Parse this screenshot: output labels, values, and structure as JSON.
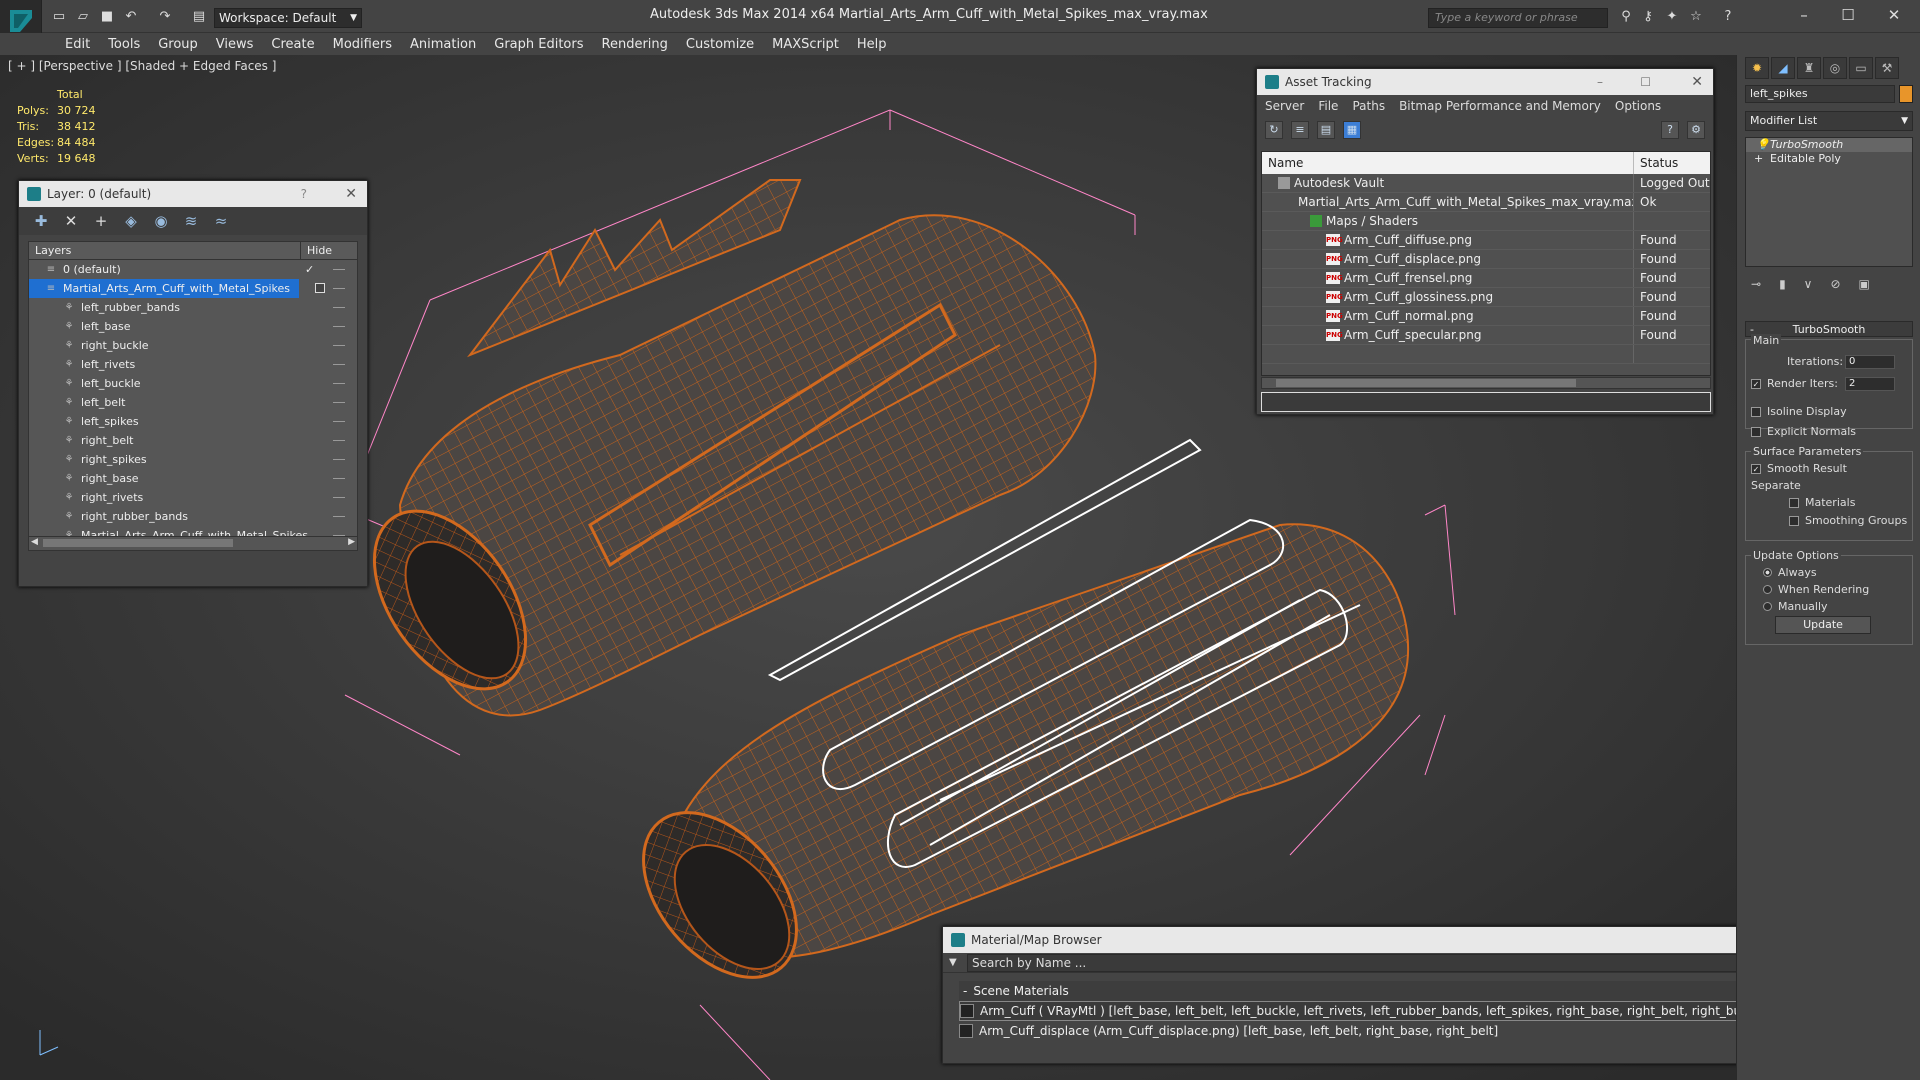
{
  "app": {
    "title": "Autodesk 3ds Max  2014 x64      Martial_Arts_Arm_Cuff_with_Metal_Spikes_max_vray.max",
    "workspace": "Workspace: Default",
    "search_placeholder": "Type a keyword or phrase"
  },
  "menu": [
    "Edit",
    "Tools",
    "Group",
    "Views",
    "Create",
    "Modifiers",
    "Animation",
    "Graph Editors",
    "Rendering",
    "Customize",
    "MAXScript",
    "Help"
  ],
  "viewport": {
    "label": "[ + ] [Perspective ] [Shaded + Edged Faces ]",
    "stats_header": "Total",
    "stats": [
      {
        "k": "Polys:",
        "v": "30 724"
      },
      {
        "k": "Tris:",
        "v": "38 412"
      },
      {
        "k": "Edges:",
        "v": "84 484"
      },
      {
        "k": "Verts:",
        "v": "19 648"
      }
    ]
  },
  "layer_panel": {
    "title": "Layer: 0 (default)",
    "help": "?",
    "col_layers": "Layers",
    "col_hide": "Hide",
    "rows": [
      {
        "label": "0 (default)",
        "indent": 0,
        "checked": true
      },
      {
        "label": "Martial_Arts_Arm_Cuff_with_Metal_Spikes",
        "indent": 0,
        "selected": true
      },
      {
        "label": "left_rubber_bands",
        "indent": 1
      },
      {
        "label": "left_base",
        "indent": 1
      },
      {
        "label": "right_buckle",
        "indent": 1
      },
      {
        "label": "left_rivets",
        "indent": 1
      },
      {
        "label": "left_buckle",
        "indent": 1
      },
      {
        "label": "left_belt",
        "indent": 1
      },
      {
        "label": "left_spikes",
        "indent": 1
      },
      {
        "label": "right_belt",
        "indent": 1
      },
      {
        "label": "right_spikes",
        "indent": 1
      },
      {
        "label": "right_base",
        "indent": 1
      },
      {
        "label": "right_rivets",
        "indent": 1
      },
      {
        "label": "right_rubber_bands",
        "indent": 1
      },
      {
        "label": "Martial_Arts_Arm_Cuff_with_Metal_Spikes",
        "indent": 1
      }
    ]
  },
  "asset_panel": {
    "title": "Asset Tracking",
    "menu": [
      "Server",
      "File",
      "Paths",
      "Bitmap Performance and Memory",
      "Options"
    ],
    "col_name": "Name",
    "col_status": "Status",
    "rows": [
      {
        "name": "Autodesk Vault",
        "status": "Logged Out ...",
        "indent": 1,
        "icon": "vault"
      },
      {
        "name": "Martial_Arts_Arm_Cuff_with_Metal_Spikes_max_vray.max",
        "status": "Ok",
        "indent": 2,
        "icon": "max"
      },
      {
        "name": "Maps / Shaders",
        "status": "",
        "indent": 3,
        "icon": "maps"
      },
      {
        "name": "Arm_Cuff_diffuse.png",
        "status": "Found",
        "indent": 4,
        "icon": "png"
      },
      {
        "name": "Arm_Cuff_displace.png",
        "status": "Found",
        "indent": 4,
        "icon": "png"
      },
      {
        "name": "Arm_Cuff_frensel.png",
        "status": "Found",
        "indent": 4,
        "icon": "png"
      },
      {
        "name": "Arm_Cuff_glossiness.png",
        "status": "Found",
        "indent": 4,
        "icon": "png"
      },
      {
        "name": "Arm_Cuff_normal.png",
        "status": "Found",
        "indent": 4,
        "icon": "png"
      },
      {
        "name": "Arm_Cuff_specular.png",
        "status": "Found",
        "indent": 4,
        "icon": "png"
      }
    ],
    "png_icon_text": "PNG"
  },
  "material_panel": {
    "title": "Material/Map Browser",
    "search_placeholder": "Search by Name ...",
    "section": "Scene Materials",
    "rows": [
      "Arm_Cuff ( VRayMtl ) [left_base, left_belt, left_buckle, left_rivets, left_rubber_bands, left_spikes, right_base, right_belt, right_buckle, right_rivets, right_rubber_bands, right_s...",
      "Arm_Cuff_displace (Arm_Cuff_displace.png) [left_base, left_belt, right_base, right_belt]"
    ]
  },
  "command_panel": {
    "object_name": "left_spikes",
    "modifier_list": "Modifier List",
    "stack": [
      "TurboSmooth",
      "Editable Poly"
    ],
    "rollout_title": "TurboSmooth",
    "main_label": "Main",
    "iterations_label": "Iterations:",
    "iterations_value": "0",
    "render_iters_label": "Render Iters:",
    "render_iters_value": "2",
    "isoline_label": "Isoline Display",
    "explicit_normals_label": "Explicit Normals",
    "surface_params_label": "Surface Parameters",
    "smooth_result_label": "Smooth Result",
    "separate_label": "Separate",
    "materials_label": "Materials",
    "smoothing_groups_label": "Smoothing Groups",
    "update_options_label": "Update Options",
    "always_label": "Always",
    "when_rendering_label": "When Rendering",
    "manually_label": "Manually",
    "update_button": "Update"
  },
  "colors": {
    "wire": "#d2691e",
    "selected_wire": "#ffffff",
    "bbox": "#ff7fbf",
    "selection": "#1f6fd1"
  }
}
